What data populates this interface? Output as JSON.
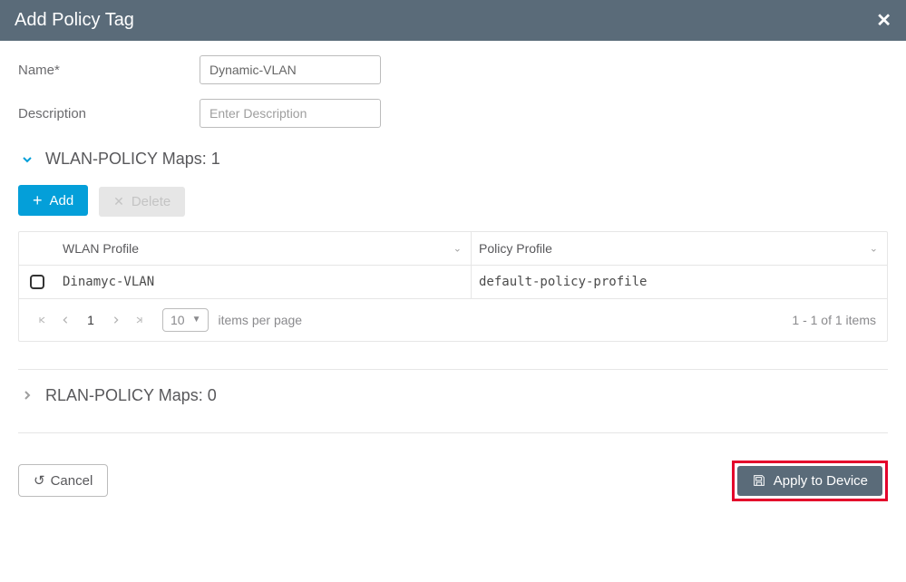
{
  "modal": {
    "title": "Add Policy Tag"
  },
  "form": {
    "name_label": "Name*",
    "name_value": "Dynamic-VLAN",
    "desc_label": "Description",
    "desc_placeholder": "Enter Description"
  },
  "sections": {
    "wlan_policy": {
      "title": "WLAN-POLICY Maps: 1",
      "expanded": true
    },
    "rlan_policy": {
      "title": "RLAN-POLICY Maps: 0",
      "expanded": false
    }
  },
  "toolbar": {
    "add_label": "Add",
    "delete_label": "Delete"
  },
  "grid": {
    "columns": {
      "wlan": "WLAN Profile",
      "policy": "Policy Profile"
    },
    "rows": [
      {
        "wlan": "Dinamyc-VLAN",
        "policy": "default-policy-profile"
      }
    ]
  },
  "pager": {
    "page": "1",
    "page_size": "10",
    "ipp_label": "items per page",
    "summary": "1 - 1 of 1 items"
  },
  "footer": {
    "cancel_label": "Cancel",
    "apply_label": "Apply to Device"
  }
}
